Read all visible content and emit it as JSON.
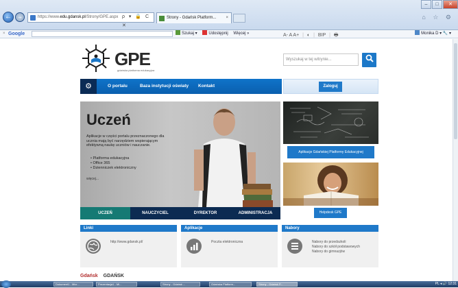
{
  "browser": {
    "url_prefix": "https://www.",
    "url_domain": "edu.gdansk.pl",
    "url_path": "/Strony/GPE.aspx",
    "addr_controls": "ρ ▾ 🔒 C ✕",
    "tab_title": "Strony - Gdańsk Platform...",
    "tab_close": "×",
    "back": "←",
    "forward": "→",
    "right_icons": "⌂ ☆ ⚙",
    "window_buttons": {
      "min": "–",
      "max": "□",
      "close": "✕"
    }
  },
  "google_bar": {
    "close": "×",
    "logo": "Google",
    "items": [
      "Szukaj ▾",
      "Udostępnij",
      "Więcej »"
    ],
    "user": "Monika D ▾",
    "wrench": "🔧 ▾"
  },
  "site": {
    "logo_text": "GPE",
    "logo_sub": "gdańska platforma edukacyjna",
    "accessibility": {
      "font_sizes": "A- A A+",
      "contrast": "◐",
      "bip": "BIP",
      "print": "🖶"
    },
    "search_placeholder": "Wyszukaj w tej witrynie...",
    "search_icon": "🔍",
    "menu": {
      "icon": "⚙",
      "items": [
        "O portalu",
        "Baza instytucji oświaty",
        "Kontakt"
      ]
    },
    "login_label": "Zaloguj",
    "hero": {
      "title": "Uczeń",
      "description": "Aplikacje w części portalu przeznaczonego dla ucznia mają być narzędziem wspierającym efektywną naukę uczniów i nauczanie.",
      "list": [
        "Platforma edukacyjna",
        "Office 365",
        "Dzienniczek elektroniczny"
      ],
      "more": "więcej..."
    },
    "hero_tabs": [
      "UCZEŃ",
      "NAUCZYCIEL",
      "DYREKTOR",
      "ADMINISTRACJA"
    ],
    "right_column": {
      "apps_button": "Aplikacje Gdańskiej Platformy Edukacyjnej",
      "helpdesk_button": "Helpdesk GPE"
    },
    "panels": [
      {
        "title": "Linki",
        "icon": "globe-icon",
        "lines": [
          "http://www.gdansk.pl/"
        ]
      },
      {
        "title": "Aplikacje",
        "icon": "chart-icon",
        "lines": [
          "Poczta elektroniczna"
        ]
      },
      {
        "title": "Nabory",
        "icon": "list-icon",
        "lines": [
          "Nabory do przedszkoli",
          "Nabory do szkół podstawowych",
          "Nabory do gimnazjów"
        ]
      }
    ],
    "footer": [
      "Gdańsk",
      "GDAŃSK"
    ]
  },
  "taskbar": {
    "buttons": [
      "Dokument1 - Micr...",
      "Prezentacja1 - Mi...",
      "Strony - Gdańsk ...",
      "Gdańska Platform...",
      "Strony - Gdańsk P..."
    ],
    "tray": "PL ◂ 🔊 12:31"
  }
}
